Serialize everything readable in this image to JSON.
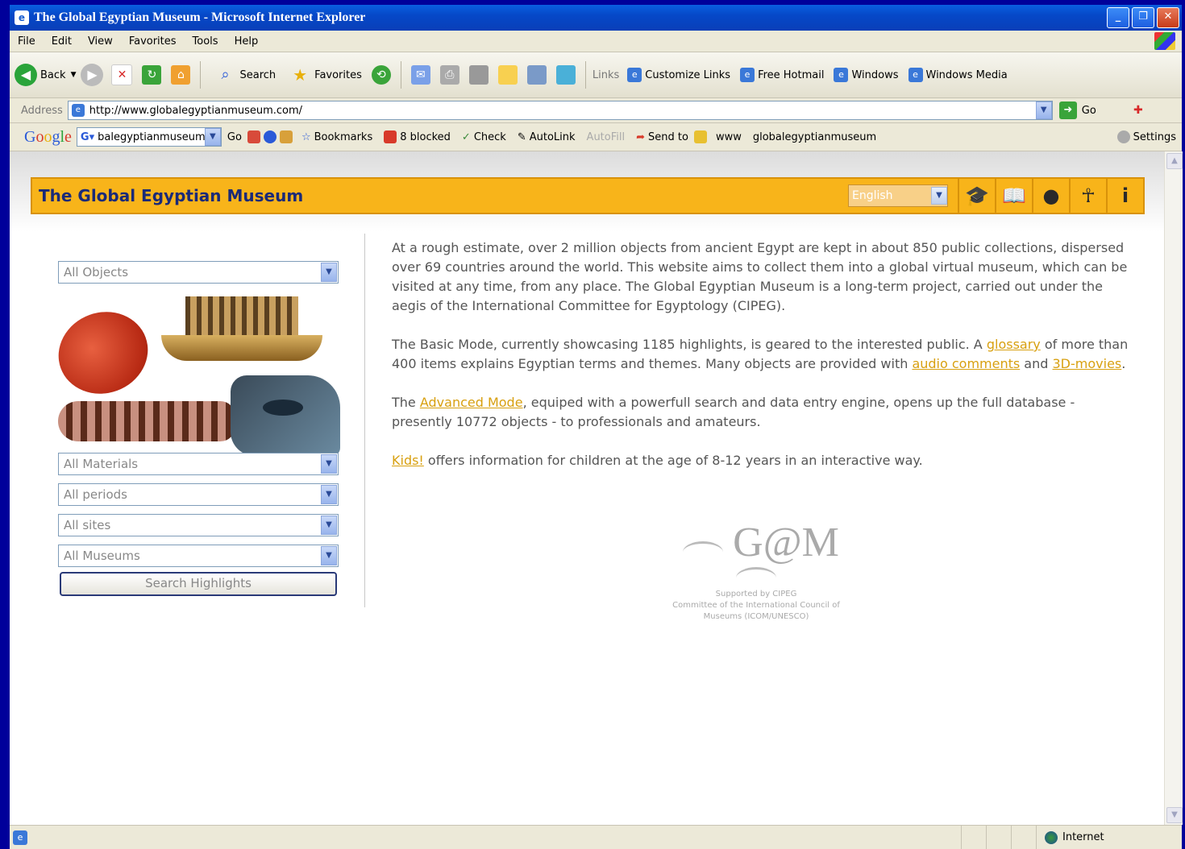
{
  "window": {
    "title": "The Global Egyptian Museum - Microsoft Internet Explorer",
    "minimize": "_",
    "maximize": "❐",
    "close": "✕"
  },
  "menu": [
    "File",
    "Edit",
    "View",
    "Favorites",
    "Tools",
    "Help"
  ],
  "toolbar": {
    "back": "Back",
    "search": "Search",
    "favorites": "Favorites",
    "links_label": "Links",
    "links": [
      "Customize Links",
      "Free Hotmail",
      "Windows",
      "Windows Media"
    ]
  },
  "address": {
    "label": "Address",
    "url": "http://www.globalegyptianmuseum.com/",
    "go": "Go"
  },
  "googlebar": {
    "search_text": "balegyptianmuseum",
    "go": "Go",
    "bookmarks": "Bookmarks",
    "blocked": "8 blocked",
    "check": "Check",
    "autolink": "AutoLink",
    "autofill": "AutoFill",
    "sendto": "Send to",
    "www": "www",
    "site": "globalegyptianmuseum",
    "settings": "Settings"
  },
  "museum": {
    "title": "The Global Egyptian Museum",
    "language": "English",
    "nav_icons": [
      "graduation-cap-icon",
      "book-icon",
      "globe-icon",
      "figure-icon",
      "info-icon"
    ]
  },
  "filters": {
    "objects": "All Objects",
    "materials": "All Materials",
    "periods": "All periods",
    "sites": "All sites",
    "museums": "All Museums",
    "search_button": "Search Highlights"
  },
  "intro": {
    "p1": "At a rough estimate, over 2 million objects from ancient Egypt are kept in about 850 public collections, dispersed over 69 countries around the world. This website aims to collect them into a global virtual museum, which can be visited at any time, from any place. The Global Egyptian Museum is a long-term project, carried out under the aegis of the International Committee for Egyptology (CIPEG).",
    "p2_a": "The Basic Mode, currently showcasing 1185 highlights, is geared to the interested public. A ",
    "p2_link1": "glossary",
    "p2_b": " of more than 400 items explains Egyptian terms and themes. Many objects are provided with ",
    "p2_link2": "audio comments",
    "p2_c": " and ",
    "p2_link3": "3D-movies",
    "p2_d": ".",
    "p3_a": "The ",
    "p3_link": "Advanced Mode",
    "p3_b": ", equiped with a powerfull search and data entry engine, opens up the full database - presently 10772 objects - to professionals and amateurs.",
    "p4_link": "Kids!",
    "p4_b": " offers information for children at the age of 8-12 years in an interactive way."
  },
  "gem": {
    "mark": "G@M",
    "line1": "Supported by CIPEG",
    "line2": "Committee of the International Council of",
    "line3": "Museums (ICOM/UNESCO)"
  },
  "status": {
    "zone": "Internet"
  },
  "colors": {
    "header": "#f8b41a",
    "title_text": "#1a2a78",
    "link": "#d8a010"
  }
}
